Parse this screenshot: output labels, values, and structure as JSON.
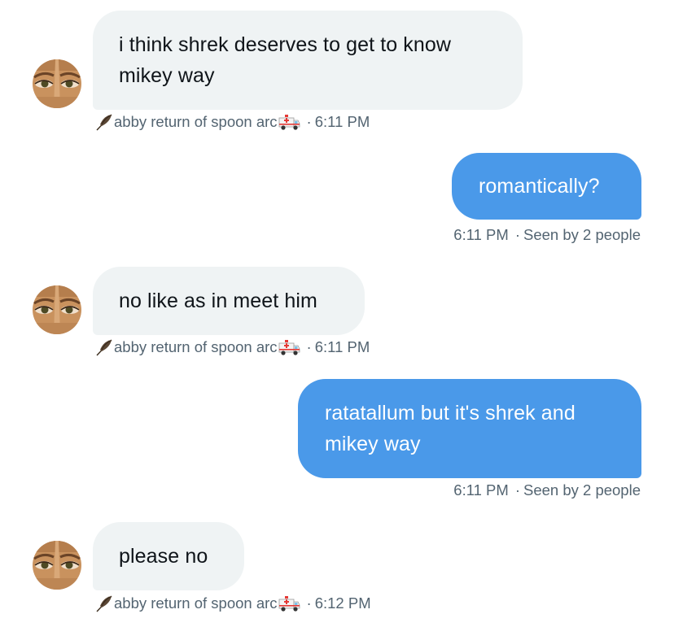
{
  "messages": [
    {
      "id": "m1",
      "direction": "incoming",
      "text": "i think shrek deserves to get to know mikey way",
      "sender": "abby return of spoon arc",
      "sender_prefix_icon": "feather-icon",
      "sender_suffix_icon": "ambulance-icon",
      "time": "6:11 PM"
    },
    {
      "id": "m2",
      "direction": "outgoing",
      "text": "romantically?",
      "time": "6:11 PM",
      "seen": "Seen by 2 people"
    },
    {
      "id": "m3",
      "direction": "incoming",
      "text": "no like as in meet him",
      "sender": "abby return of spoon arc",
      "sender_prefix_icon": "feather-icon",
      "sender_suffix_icon": "ambulance-icon",
      "time": "6:11 PM"
    },
    {
      "id": "m4",
      "direction": "outgoing",
      "text": "ratatallum but it's shrek and mikey way",
      "time": "6:11 PM",
      "seen": "Seen by 2 people"
    },
    {
      "id": "m5",
      "direction": "incoming",
      "text": "please no",
      "sender": "abby return of spoon arc",
      "sender_prefix_icon": "feather-icon",
      "sender_suffix_icon": "ambulance-icon",
      "time": "6:12 PM"
    }
  ],
  "separator": "·",
  "colors": {
    "incoming_bubble": "#eff3f4",
    "outgoing_bubble": "#4a99e9",
    "meta_text": "#536471"
  }
}
